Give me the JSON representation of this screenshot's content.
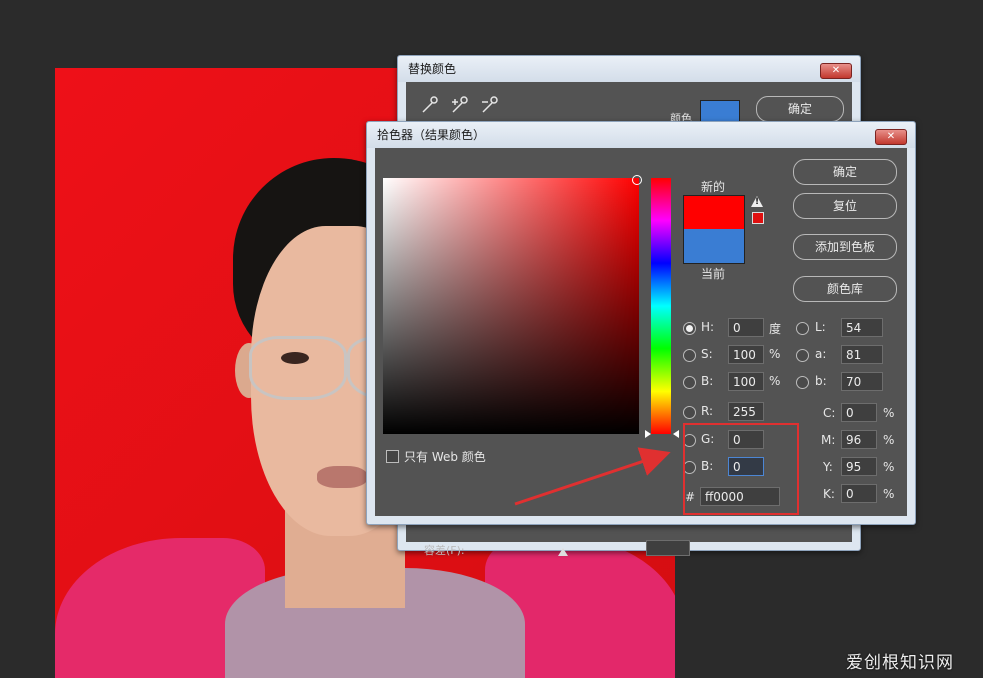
{
  "background_dialog": {
    "title": "替换颜色",
    "ok_label": "确定",
    "partial_label": "颜色",
    "partial_label2": "容差(F):",
    "close_glyph": "✕",
    "result_swatch_color": "#3a7dd3"
  },
  "color_picker": {
    "title": "拾色器（结果颜色）",
    "close_glyph": "✕",
    "new_label": "新的",
    "current_label": "当前",
    "new_color": "#ff0000",
    "current_color": "#3a7dd3",
    "buttons": {
      "ok": "确定",
      "reset": "复位",
      "add_to_swatches": "添加到色板",
      "color_libraries": "颜色库"
    },
    "web_only_label": "只有 Web 颜色",
    "hsb": {
      "h": {
        "label": "H:",
        "value": "0",
        "unit": "度"
      },
      "s": {
        "label": "S:",
        "value": "100",
        "unit": "%"
      },
      "b": {
        "label": "B:",
        "value": "100",
        "unit": "%"
      }
    },
    "lab": {
      "l": {
        "label": "L:",
        "value": "54"
      },
      "a": {
        "label": "a:",
        "value": "81"
      },
      "b": {
        "label": "b:",
        "value": "70"
      }
    },
    "rgb": {
      "r": {
        "label": "R:",
        "value": "255"
      },
      "g": {
        "label": "G:",
        "value": "0"
      },
      "b": {
        "label": "B:",
        "value": "0"
      }
    },
    "cmyk": {
      "c": {
        "label": "C:",
        "value": "0",
        "unit": "%"
      },
      "m": {
        "label": "M:",
        "value": "96",
        "unit": "%"
      },
      "y": {
        "label": "Y:",
        "value": "95",
        "unit": "%"
      },
      "k": {
        "label": "K:",
        "value": "0",
        "unit": "%"
      }
    },
    "hex": {
      "label": "#",
      "value": "ff0000"
    }
  },
  "annotation": {
    "highlight_color": "#e03030"
  },
  "watermark": {
    "text": "爱创根知识网"
  }
}
